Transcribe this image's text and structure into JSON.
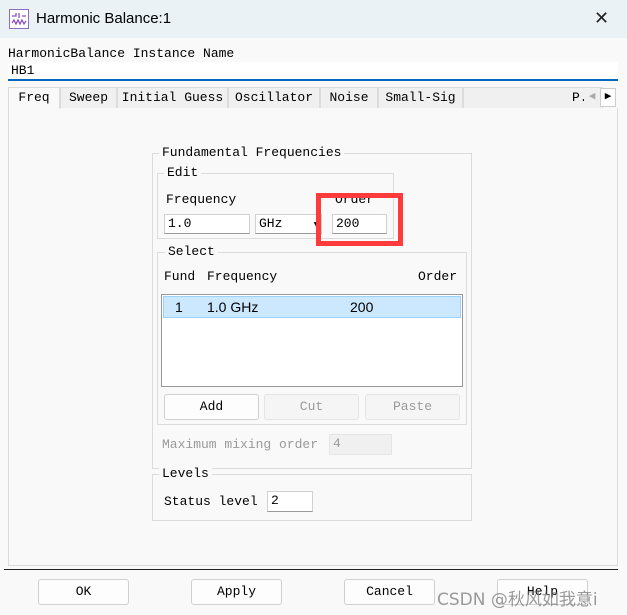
{
  "window": {
    "title": "Harmonic Balance:1",
    "app_icon": "harmonic-balance-icon",
    "close_icon": "close-icon"
  },
  "instance": {
    "label": "HarmonicBalance Instance Name",
    "value": "HB1"
  },
  "tabs": [
    {
      "label": "Freq",
      "active": true
    },
    {
      "label": "Sweep"
    },
    {
      "label": "Initial Guess"
    },
    {
      "label": "Oscillator"
    },
    {
      "label": "Noise"
    },
    {
      "label": "Small-Sig"
    },
    {
      "label": "P..."
    }
  ],
  "fundamental": {
    "title": "Fundamental Frequencies",
    "edit": {
      "title": "Edit",
      "frequency_label": "Frequency",
      "frequency_value": "1.0",
      "unit": "GHz",
      "order_label": "Order",
      "order_value": "200"
    },
    "select": {
      "title": "Select",
      "columns": [
        "Fund",
        "Frequency",
        "Order"
      ],
      "rows": [
        {
          "fund": "1",
          "frequency": "1.0 GHz",
          "order": "200",
          "selected": true
        }
      ],
      "buttons": {
        "add": "Add",
        "cut": "Cut",
        "paste": "Paste"
      }
    },
    "max_mixing_label": "Maximum mixing order",
    "max_mixing_value": "4"
  },
  "levels": {
    "title": "Levels",
    "status_label": "Status level",
    "status_value": "2"
  },
  "footer": {
    "ok": "OK",
    "apply": "Apply",
    "cancel": "Cancel",
    "help": "Help"
  },
  "watermark": "CSDN @秋风如我意i",
  "colors": {
    "highlight": "#ff3b3b",
    "selection": "#cce8ff",
    "input_focus": "#0067c0"
  }
}
